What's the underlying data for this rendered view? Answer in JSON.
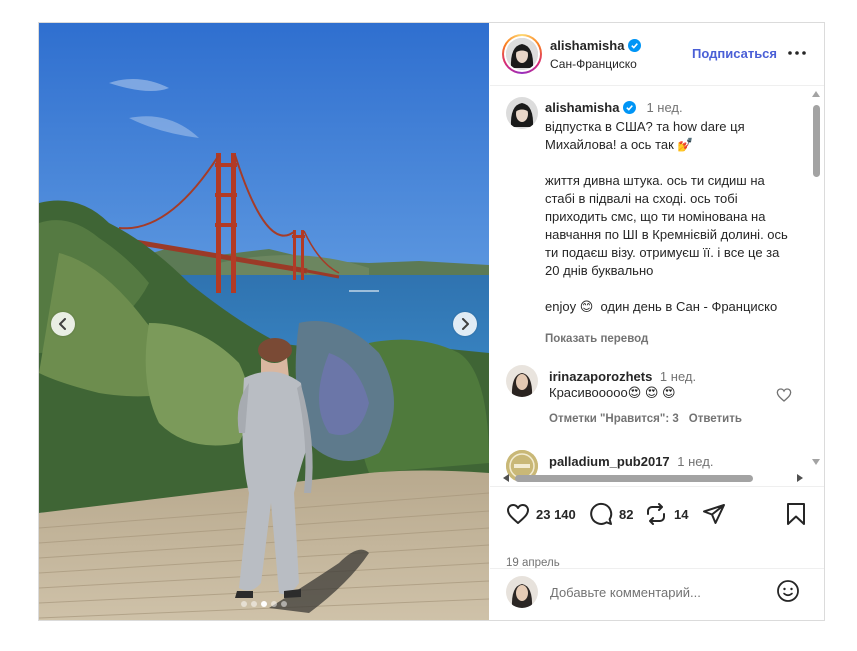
{
  "post": {
    "header": {
      "username": "alishamisha",
      "location": "Сан-Франциско",
      "follow_label": "Подписаться"
    },
    "caption": {
      "username": "alishamisha",
      "time": "1 нед.",
      "text": "відпустка в США? та how dare ця Михайлова! а ось так 💅\n\nжиття дивна штука. ось ти сидиш на стабі в підвалі на сході. ось тобі приходить смс, що ти номінована на навчання по ШІ в Кремнієвій долині. ось ти подаєш візу. отримуєш її. і все це за 20 днів буквально\n\nenjoy 😊  один день в Сан - Франциско",
      "translate_label": "Показать перевод"
    },
    "comments": [
      {
        "username": "irinazaporozhets",
        "time": "1 нед.",
        "text": "Красивооооо😍 😍 😍",
        "likes_label": "Отметки \"Нравится\": 3",
        "reply_label": "Ответить"
      },
      {
        "username": "palladium_pub2017",
        "time": "1 нед."
      }
    ],
    "actions": {
      "likes": "23 140",
      "comments": "82",
      "reposts": "14"
    },
    "date": "19 апрель",
    "add_comment_placeholder": "Добавьте комментарий...",
    "carousel": {
      "slide_count": 5,
      "active_index": 2
    },
    "colors": {
      "accent": "#4a5fd6",
      "text": "#262626",
      "muted": "#737373"
    },
    "icons": [
      "chevron-left-icon",
      "chevron-right-icon",
      "verified-badge-icon",
      "more-icon",
      "heart-icon",
      "comment-icon",
      "repost-icon",
      "share-icon",
      "bookmark-icon",
      "emoji-icon"
    ]
  }
}
